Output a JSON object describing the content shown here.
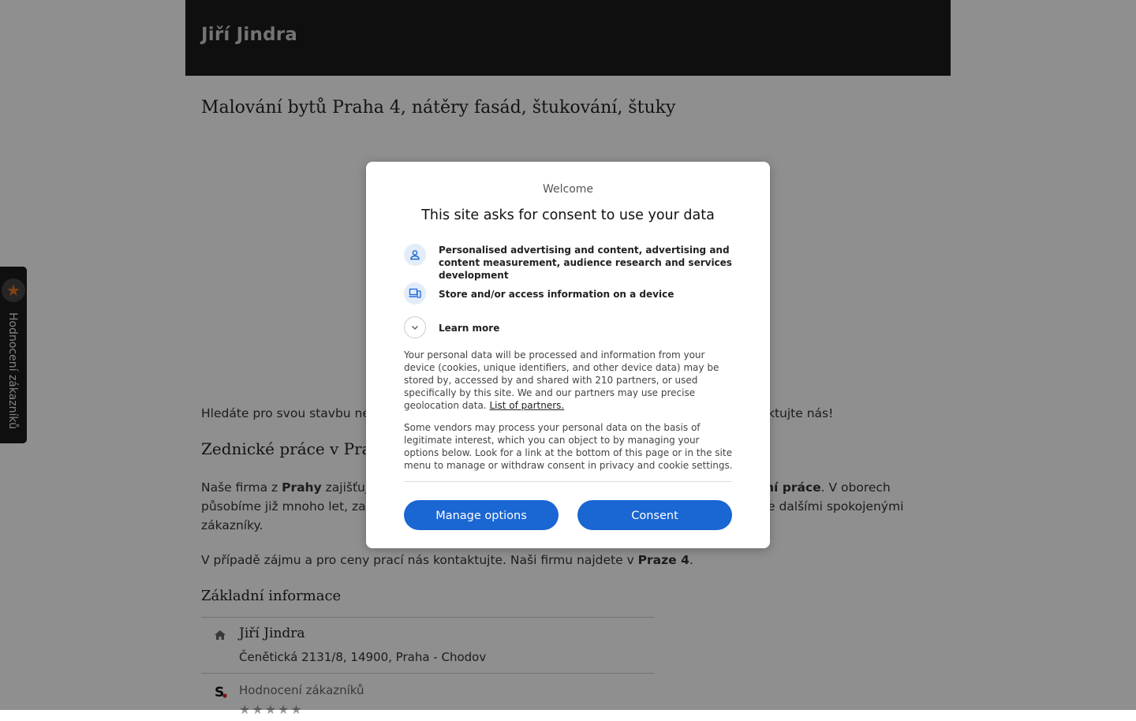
{
  "header": {
    "brand": "Jiří Jindra"
  },
  "main": {
    "title": "Malování bytů Praha 4, nátěry fasád, štukování, štuky",
    "intro_left": "Hledáte pro svou stavbu ne",
    "intro_right": "ktujte nás!",
    "section_heading": "Zednické práce v Praz",
    "firm_para": {
      "l1_a": "Naše firma z ",
      "l1_b": "Prahy",
      "l1_c": " zajišťuje",
      "l1_d": "ní práce",
      "l1_e": ". V oborech",
      "l2_a": "působíme již mnoho let, zar",
      "l2_b": "e dalšími spokojenými",
      "l3": "zákazníky."
    },
    "contact_para": {
      "a": "V případě zájmu a pro ceny prací nás kontaktujte. Naši firmu najdete v ",
      "b": "Praze 4",
      "c": "."
    },
    "basic_info": {
      "heading": "Základní informace",
      "name": "Jiří Jindra",
      "address": "Čenětická 2131/8, 14900, Praha - Chodov",
      "rating_label": "Hodnocení zákazníků",
      "stars": "★★★★★"
    }
  },
  "side_tab": {
    "label": "Hodnocení zákazníků"
  },
  "consent_dialog": {
    "welcome": "Welcome",
    "title": "This site asks for consent to use your data",
    "purposes": [
      {
        "icon": "person-icon",
        "text": "Personalised advertising and content, advertising and content measurement, audience research and services development"
      },
      {
        "icon": "devices-icon",
        "text": "Store and/or access information on a device"
      },
      {
        "icon": "chevron-down-icon",
        "text": "Learn more"
      }
    ],
    "body_1": "Your personal data will be processed and information from your device (cookies, unique identifiers, and other device data) may be stored by, accessed by and shared with 210 partners, or used specifically by this site. We and our partners may use precise geolocation data.",
    "partners_link": "List of partners.",
    "body_2": "Some vendors may process your personal data on the basis of legitimate interest, which you can object to by managing your options below. Look for a link at the bottom of this page or in the site menu to manage or withdraw consent in privacy and cookie settings.",
    "manage_label": "Manage options",
    "consent_label": "Consent"
  },
  "colors": {
    "header_bg": "#1b1b1b",
    "button_blue": "#1a66d2",
    "overlay": "rgba(0,0,0,0.44)",
    "side_star": "#e87722"
  }
}
